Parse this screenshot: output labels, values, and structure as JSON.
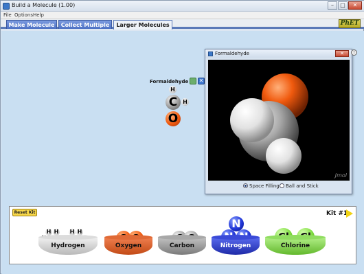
{
  "window": {
    "title": "Build a Molecule (1.00)"
  },
  "menu": [
    "File",
    "Options",
    "Help"
  ],
  "tabs": [
    {
      "label": "Make Molecule",
      "active": false
    },
    {
      "label": "Collect Multiple",
      "active": false
    },
    {
      "label": "Larger Molecules",
      "active": true
    }
  ],
  "brand": "PhET",
  "molecule": {
    "name": "Formaldehyde",
    "atoms": [
      "H",
      "C",
      "H",
      "O"
    ]
  },
  "dialog": {
    "title": "Formaldehyde",
    "watermark": "Jmol",
    "options": [
      {
        "label": "Space Filling",
        "selected": true
      },
      {
        "label": "Ball and Stick",
        "selected": false
      }
    ]
  },
  "kit": {
    "reset_label": "Reset Kit",
    "label": "Kit #1",
    "buckets": [
      {
        "name": "Hydrogen",
        "symbol": "H",
        "color": "#d8d8d8"
      },
      {
        "name": "Oxygen",
        "symbol": "O",
        "color": "#e8642a"
      },
      {
        "name": "Carbon",
        "symbol": "C",
        "color": "#9a9a9a"
      },
      {
        "name": "Nitrogen",
        "symbol": "N",
        "color": "#3040d8"
      },
      {
        "name": "Chlorine",
        "symbol": "Cl",
        "color": "#86dd48"
      }
    ]
  },
  "colors": {
    "accent": "#5a79b8",
    "play_area": "#c9dff2",
    "reset": "#f7d74a"
  }
}
